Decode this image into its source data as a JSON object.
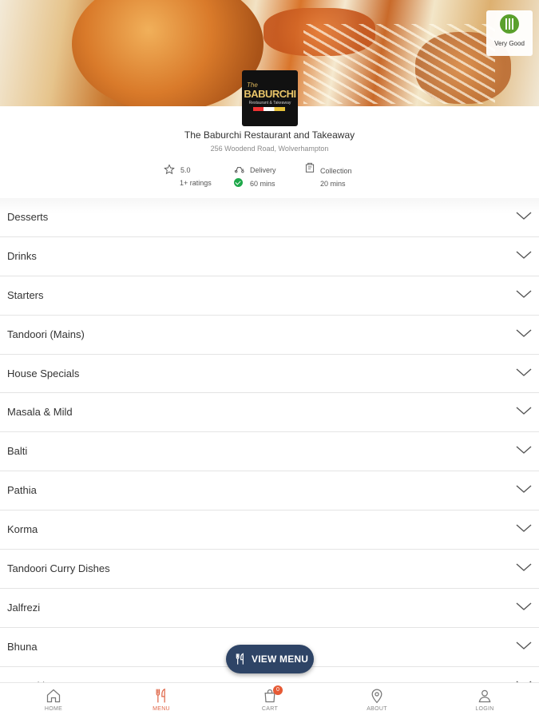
{
  "hygiene": {
    "label": "Very Good"
  },
  "restaurant": {
    "logo": {
      "the": "The",
      "name": "BABURCHI",
      "sub": "Restaurant & Takeaway"
    },
    "name": "The Baburchi Restaurant and Takeaway",
    "address": "256 Woodend Road, Wolverhampton"
  },
  "stats": {
    "rating": {
      "value": "5.0",
      "count": "1+ ratings"
    },
    "delivery": {
      "label": "Delivery",
      "time": "60 mins"
    },
    "collection": {
      "label": "Collection",
      "time": "20 mins"
    }
  },
  "menu": {
    "categories": [
      "Desserts",
      "Drinks",
      "Starters",
      "Tandoori (Mains)",
      "House Specials",
      "Masala & Mild",
      "Balti",
      "Pathia",
      "Korma",
      "Tandoori Curry Dishes",
      "Jalfrezi",
      "Bhuna",
      "Dopaski"
    ]
  },
  "fab": {
    "label": "VIEW MENU"
  },
  "tabbar": {
    "home": "HOME",
    "menu": "MENU",
    "cart": "CART",
    "cart_count": "0",
    "about": "ABOUT",
    "login": "LOGIN",
    "active_color": "#e0684a"
  }
}
